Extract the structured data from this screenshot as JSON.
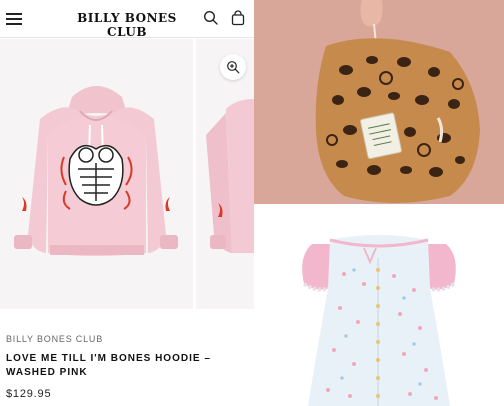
{
  "header": {
    "logo_text": "BILLY BONES CLUB",
    "menu_icon": "hamburger-menu-icon",
    "search_icon": "search-icon",
    "bag_icon": "shopping-bag-icon"
  },
  "product": {
    "vendor": "BILLY BONES CLUB",
    "title": "LOVE ME TILL I'M BONES HOODIE – WASHED PINK",
    "price": "$129.95",
    "zoom_icon": "zoom-in-icon"
  },
  "colors": {
    "hoodie_pink": "#f3c9d3",
    "accent_red": "#d83a2a",
    "leopard_bg": "#d9a79a"
  }
}
